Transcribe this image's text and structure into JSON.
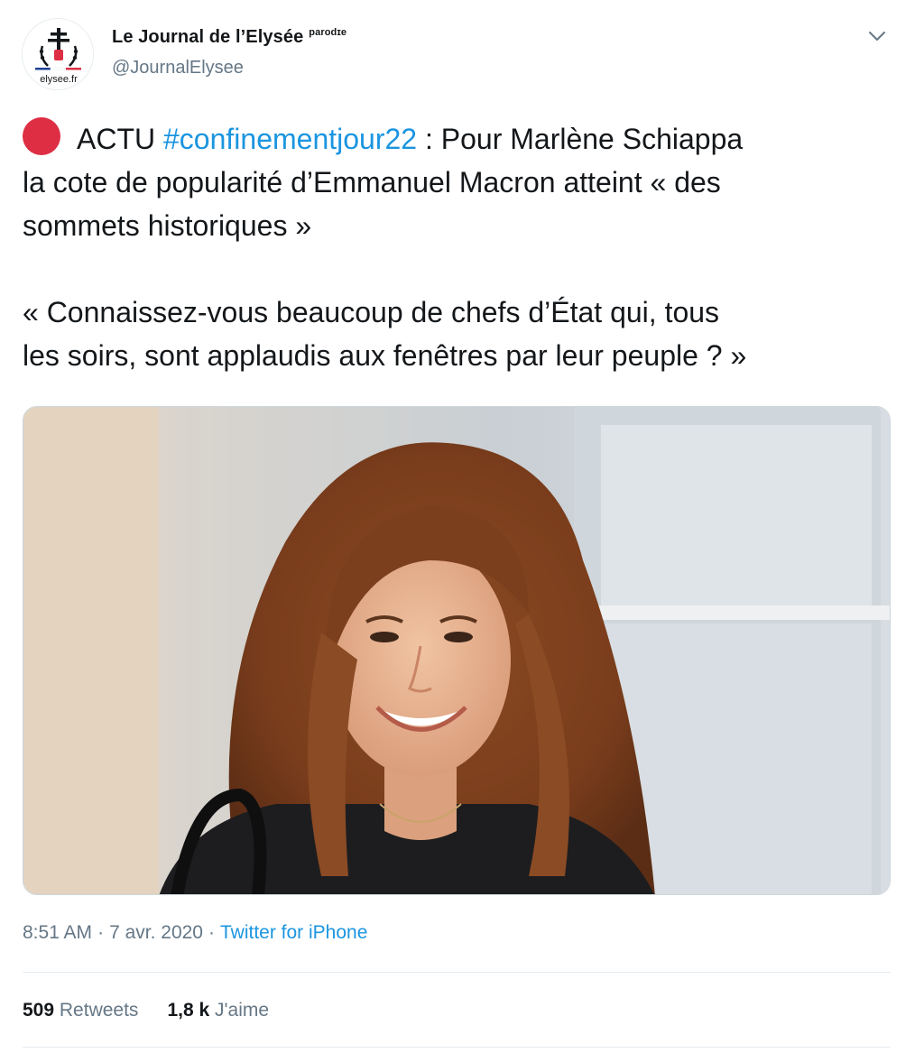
{
  "author": {
    "display_name": "Le Journal de l’Elysée",
    "badge": "parodɪe",
    "handle": "@JournalElysee",
    "avatar_caption": "elysee.fr",
    "avatar_icon": "elysee-logo-icon",
    "menu_icon": "chevron-down-icon"
  },
  "tweet": {
    "line1_prefix": "ACTU",
    "hashtag": "#confinementjour22",
    "line1_suffix": ": Pour Marlène Schiappa",
    "line2": "la cote de popularité d’Emmanuel Macron atteint  « des",
    "line3": "sommets historiques »",
    "line4": "« Connaissez-vous beaucoup de chefs d’État qui, tous",
    "line5": "les soirs, sont applaudis aux fenêtres par leur peuple ? »",
    "emoji": "red-circle-icon",
    "photo_icon": "photo-of-smiling-woman"
  },
  "meta": {
    "time": "8:51 AM",
    "separator": "·",
    "date": "7 avr. 2020",
    "source": "Twitter for iPhone"
  },
  "stats": {
    "retweets_count": "509",
    "retweets_label": "Retweets",
    "likes_count": "1,8 k",
    "likes_label": "J'aime"
  },
  "colors": {
    "text": "#14171a",
    "secondary": "#657786",
    "link": "#1b95e0",
    "divider": "#e6ecf0",
    "emoji_red": "#dd2e44"
  }
}
